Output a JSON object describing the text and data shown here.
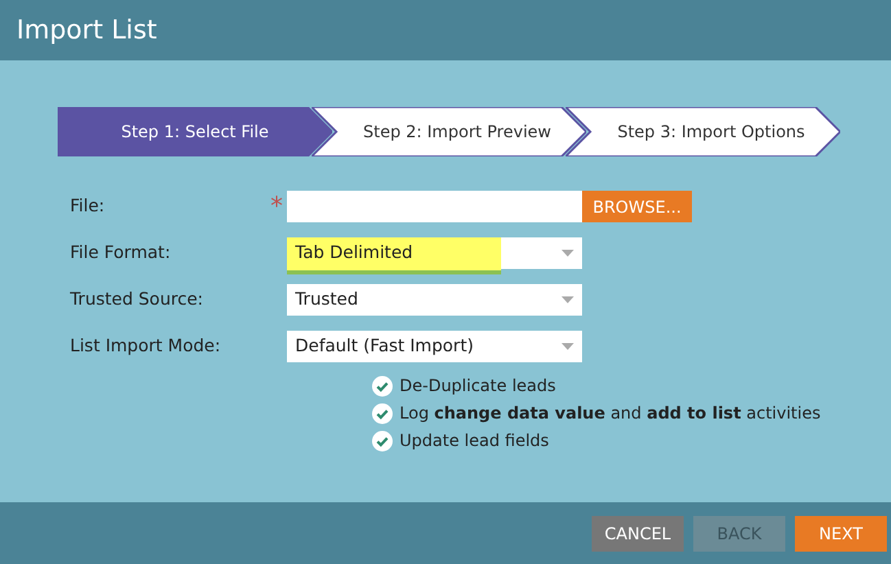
{
  "window": {
    "title": "Import List"
  },
  "steps": [
    {
      "label": "Step 1: Select File",
      "selected": true
    },
    {
      "label": "Step 2: Import Preview",
      "selected": false
    },
    {
      "label": "Step 3: Import Options",
      "selected": false
    }
  ],
  "fields": [
    {
      "kind": "file",
      "label": "File:",
      "required_mark": "*",
      "button": "BROWSE..."
    },
    {
      "kind": "select",
      "label": "File Format:",
      "value": "Tab Delimited",
      "highlighted": true
    },
    {
      "kind": "select",
      "label": "Trusted Source:",
      "value": "Trusted",
      "highlighted": false
    },
    {
      "kind": "select",
      "label": "List Import Mode:",
      "value": "Default (Fast Import)",
      "highlighted": false
    }
  ],
  "options": [
    {
      "text": "De-Duplicate leads",
      "checked": true
    },
    {
      "text": "Log **change data value** and **add to list** activities",
      "checked": true
    },
    {
      "text": "Update lead fields",
      "checked": true
    }
  ],
  "buttons": [
    {
      "label": "CANCEL",
      "kind": "secondary",
      "disabled": false
    },
    {
      "label": "BACK",
      "kind": "secondary",
      "disabled": true
    },
    {
      "label": "NEXT",
      "kind": "primary",
      "disabled": false
    }
  ]
}
